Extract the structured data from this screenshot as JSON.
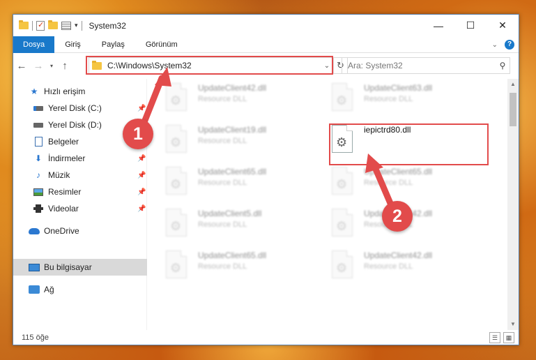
{
  "window": {
    "title": "System32",
    "controls": {
      "minimize": "—",
      "maximize": "☐",
      "close": "✕"
    }
  },
  "ribbon": {
    "tabs": [
      {
        "label": "Dosya",
        "active": true
      },
      {
        "label": "Giriş"
      },
      {
        "label": "Paylaş"
      },
      {
        "label": "Görünüm"
      }
    ]
  },
  "navbar": {
    "address": "C:\\Windows\\System32",
    "search_placeholder": "Ara: System32"
  },
  "sidebar": {
    "items": [
      {
        "label": "Hızlı erişim",
        "icon": "star-icon"
      },
      {
        "label": "Yerel Disk (C:)",
        "icon": "drive-icon",
        "pinned": true
      },
      {
        "label": "Yerel Disk (D:)",
        "icon": "drive-icon"
      },
      {
        "label": "Belgeler",
        "icon": "documents-icon",
        "pinned": true
      },
      {
        "label": "İndirmeler",
        "icon": "downloads-icon",
        "pinned": true
      },
      {
        "label": "Müzik",
        "icon": "music-icon",
        "pinned": true
      },
      {
        "label": "Resimler",
        "icon": "pictures-icon",
        "pinned": true
      },
      {
        "label": "Videolar",
        "icon": "videos-icon",
        "pinned": true
      },
      {
        "label": "OneDrive",
        "icon": "onedrive-icon"
      },
      {
        "label": "Bu bilgisayar",
        "icon": "this-pc-icon",
        "selected": true
      },
      {
        "label": "Ağ",
        "icon": "network-icon"
      }
    ]
  },
  "files": [
    {
      "name": "UpdateClient42.dll",
      "desc": "Resource DLL"
    },
    {
      "name": "UpdateClient63.dll",
      "desc": "Resource DLL"
    },
    {
      "name": "UpdateClient19.dll",
      "desc": "Resource DLL"
    },
    {
      "name": "iepictrd80.dll",
      "desc": ""
    },
    {
      "name": "UpdateClient65.dll",
      "desc": "Resource DLL"
    },
    {
      "name": "UpdateClient65.dll",
      "desc": "Resource DLL"
    },
    {
      "name": "UpdateClient5.dll",
      "desc": "Resource DLL"
    },
    {
      "name": "UpdateClient42.dll",
      "desc": "Resource DLL"
    },
    {
      "name": "UpdateClient65.dll",
      "desc": "Resource DLL"
    },
    {
      "name": "UpdateClient42.dll",
      "desc": "Resource DLL"
    }
  ],
  "status": {
    "count": "115 öğe"
  },
  "annotations": {
    "step1": "1",
    "step2": "2",
    "color": "#e24b4b"
  }
}
